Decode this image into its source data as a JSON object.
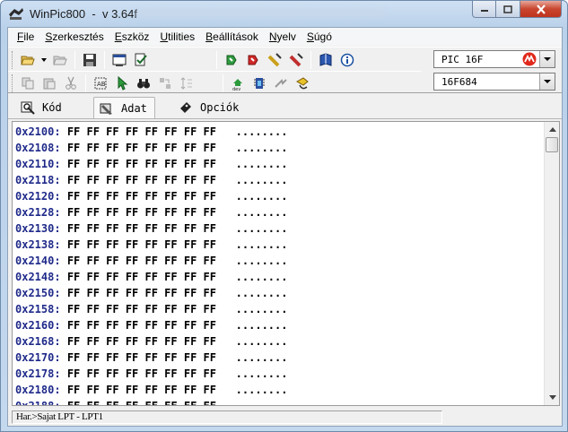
{
  "window": {
    "app_name": "WinPic800",
    "separator": "-",
    "version": "v 3.64f"
  },
  "menu": [
    {
      "label": "File",
      "accel": "F",
      "rest": "ile"
    },
    {
      "label": "Szerkesztés",
      "accel": "S",
      "rest": "zerkesztés"
    },
    {
      "label": "Eszköz",
      "accel": "E",
      "rest": "szköz"
    },
    {
      "label": "Utilities",
      "accel": "U",
      "rest": "tilities"
    },
    {
      "label": "Beállítások",
      "accel": "B",
      "rest": "eállítások"
    },
    {
      "label": "Nyelv",
      "accel": "N",
      "rest": "yelv"
    },
    {
      "label": "Súgó",
      "accel": "S",
      "rest": "úgó"
    }
  ],
  "toolbar": {
    "row1_icons": [
      "open-folder-icon",
      "dropdown-arrow-icon",
      "open-folder-disabled-icon",
      "save-icon",
      "window-icon",
      "check-document-icon",
      "read-chip-icon",
      "write-chip-icon",
      "verify-chip-icon",
      "erase-chip-icon",
      "book-icon",
      "info-icon"
    ],
    "row2_icons": [
      "copy-icon",
      "paste-icon",
      "cut-icon",
      "select-icon",
      "cursor-icon",
      "binoculars-icon",
      "find-replace-icon",
      "height-icon",
      "device-detect-icon",
      "blank-check-icon",
      "flash-icon",
      "chip-hand-icon"
    ]
  },
  "device": {
    "family": "PIC 16F",
    "model": "16F684",
    "brand_color": "#e0281b"
  },
  "tabs": [
    {
      "label": "Kód"
    },
    {
      "label": "Adat"
    },
    {
      "label": "Opciók"
    }
  ],
  "hex": {
    "rows": [
      {
        "addr": "0x2100:",
        "bytes": "FF FF FF FF FF FF FF FF",
        "ascii": "........"
      },
      {
        "addr": "0x2108:",
        "bytes": "FF FF FF FF FF FF FF FF",
        "ascii": "........"
      },
      {
        "addr": "0x2110:",
        "bytes": "FF FF FF FF FF FF FF FF",
        "ascii": "........"
      },
      {
        "addr": "0x2118:",
        "bytes": "FF FF FF FF FF FF FF FF",
        "ascii": "........"
      },
      {
        "addr": "0x2120:",
        "bytes": "FF FF FF FF FF FF FF FF",
        "ascii": "........"
      },
      {
        "addr": "0x2128:",
        "bytes": "FF FF FF FF FF FF FF FF",
        "ascii": "........"
      },
      {
        "addr": "0x2130:",
        "bytes": "FF FF FF FF FF FF FF FF",
        "ascii": "........"
      },
      {
        "addr": "0x2138:",
        "bytes": "FF FF FF FF FF FF FF FF",
        "ascii": "........"
      },
      {
        "addr": "0x2140:",
        "bytes": "FF FF FF FF FF FF FF FF",
        "ascii": "........"
      },
      {
        "addr": "0x2148:",
        "bytes": "FF FF FF FF FF FF FF FF",
        "ascii": "........"
      },
      {
        "addr": "0x2150:",
        "bytes": "FF FF FF FF FF FF FF FF",
        "ascii": "........"
      },
      {
        "addr": "0x2158:",
        "bytes": "FF FF FF FF FF FF FF FF",
        "ascii": "........"
      },
      {
        "addr": "0x2160:",
        "bytes": "FF FF FF FF FF FF FF FF",
        "ascii": "........"
      },
      {
        "addr": "0x2168:",
        "bytes": "FF FF FF FF FF FF FF FF",
        "ascii": "........"
      },
      {
        "addr": "0x2170:",
        "bytes": "FF FF FF FF FF FF FF FF",
        "ascii": "........"
      },
      {
        "addr": "0x2178:",
        "bytes": "FF FF FF FF FF FF FF FF",
        "ascii": "........"
      },
      {
        "addr": "0x2180:",
        "bytes": "FF FF FF FF FF FF FF FF",
        "ascii": "........"
      },
      {
        "addr": "0x2188:",
        "bytes": "FF FF FF FF FF FF FF FF",
        "ascii": "........"
      }
    ]
  },
  "status": {
    "text": "Har.>Sajat LPT - LPT1"
  }
}
